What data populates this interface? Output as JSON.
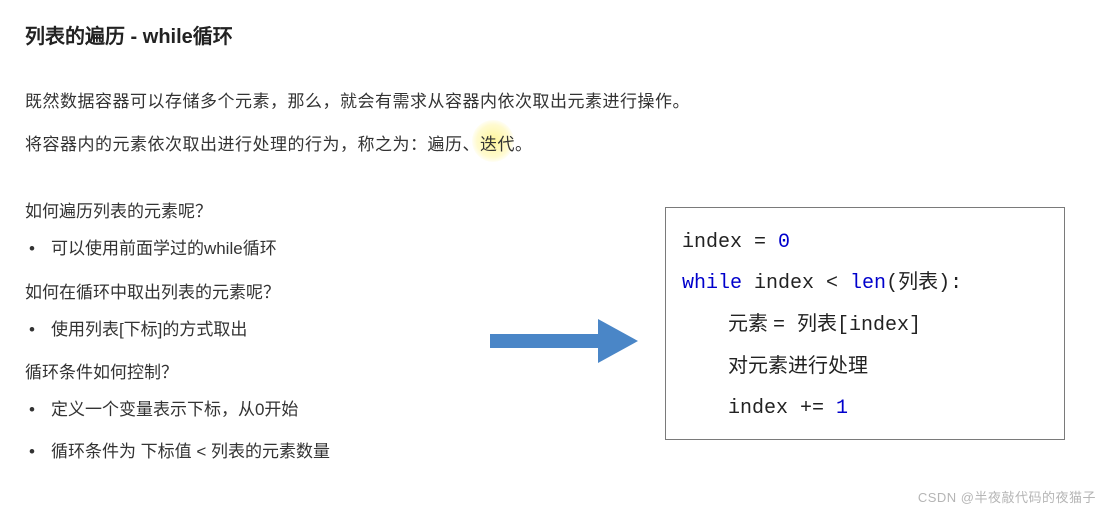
{
  "title": "列表的遍历 - while循环",
  "intro": {
    "line1": "既然数据容器可以存储多个元素，那么，就会有需求从容器内依次取出元素进行操作。",
    "line2_prefix": "将容器内的元素依次取出进行处理的行为，称之为：遍历、",
    "line2_highlight": "迭代",
    "line2_suffix": "。"
  },
  "qa": {
    "q1": "如何遍历列表的元素呢？",
    "a1": "可以使用前面学过的while循环",
    "q2": "如何在循环中取出列表的元素呢？",
    "a2": "使用列表[下标]的方式取出",
    "q3": "循环条件如何控制？",
    "a3": "定义一个变量表示下标，从0开始",
    "a4": "循环条件为 下标值 < 列表的元素数量"
  },
  "code": {
    "l1_a": "index ",
    "l1_b": "= ",
    "l1_c": "0",
    "l2_a": "while",
    "l2_b": " index ",
    "l2_c": "< ",
    "l2_d": "len",
    "l2_e": "(列表):",
    "l3_a": "元素 ",
    "l3_b": "= ",
    "l3_c": "列表[index]",
    "l4": "对元素进行处理",
    "l5_a": "index ",
    "l5_b": "+= ",
    "l5_c": "1"
  },
  "watermark": "CSDN @半夜敲代码的夜猫子"
}
